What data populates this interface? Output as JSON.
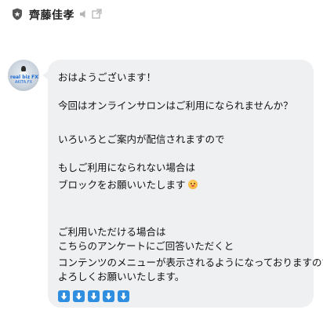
{
  "header": {
    "contact_name": "齊藤佳孝",
    "icons": [
      "shield-icon",
      "mute-icon",
      "external-link-icon"
    ]
  },
  "avatar": {
    "caption_line1": "real biz FX",
    "caption_line2": "AKITA.FX"
  },
  "message": {
    "lines": [
      "おはようございます！",
      "今回はオンラインサロンはご利用になられませんか？",
      "いろいろとご案内が配信されますので",
      "もしご利用になられない場合は",
      "ブロックをお願いいたします",
      "ご利用いただける場合は",
      "こちらのアンケートにご回答いただくと",
      "コンテンツのメニューが表示されるようになっておりますので",
      "よろしくお願いいたします。"
    ],
    "emoji": "crying-face-emoji",
    "arrow_count": 5,
    "arrow_icon": "down-arrow-key-emoji",
    "bubble_color": "#eef0f2",
    "arrow_color": "#2f8ee0"
  }
}
